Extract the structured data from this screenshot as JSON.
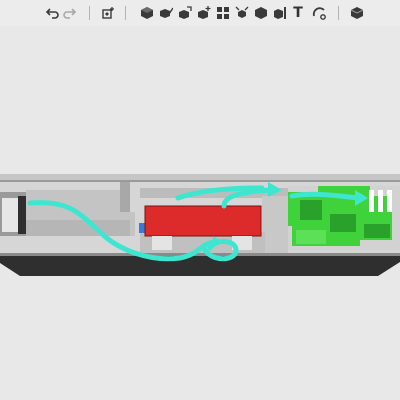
{
  "toolbar": {
    "undo_icon": "undo-arrow-icon",
    "redo_icon": "redo-arrow-icon",
    "text_tool_label": "T",
    "icon_color": "#3a3a3a",
    "disabled_icon_color": "#a8a8a8"
  },
  "scene": {
    "background": "#e8e8e8",
    "colors": {
      "housing_light": "#d6d6d6",
      "housing_mid": "#c2c2c2",
      "housing_dark": "#8a8a8a",
      "base_dark": "#2f2f2f",
      "battery_red": "#dd2a2a",
      "pcb_green": "#3fd23a",
      "pcb_green_dark": "#2aa12a",
      "flow_arrow": "#3fe6cf",
      "blue_part": "#3a7ad8"
    }
  }
}
